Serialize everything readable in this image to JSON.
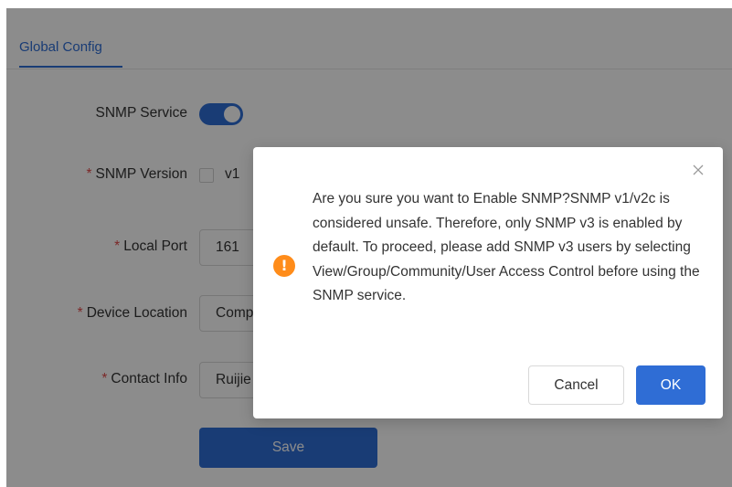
{
  "tabs": {
    "active_label": "Global Config"
  },
  "form": {
    "snmp_service_label": "SNMP Service",
    "snmp_service_on": true,
    "snmp_version_label": "SNMP Version",
    "snmp_version_option": "v1",
    "local_port_label": "Local Port",
    "local_port_value": "161",
    "device_location_label": "Device Location",
    "device_location_value": "Company Address",
    "contact_info_label": "Contact Info",
    "contact_info_value": "Ruijie Networks",
    "required_mark": "*",
    "save_label": "Save"
  },
  "dialog": {
    "message": "Are you sure you want to Enable SNMP?SNMP v1/v2c is considered unsafe. Therefore, only SNMP v3 is enabled by default. To proceed, please add SNMP v3 users by selecting View/Group/Community/User Access Control before using the SNMP service.",
    "cancel_label": "Cancel",
    "ok_label": "OK",
    "warning_glyph": "!",
    "icon": "warning-circle-icon"
  },
  "colors": {
    "primary": "#2f6dd5",
    "warning": "#ff8c1a",
    "required": "#e24a4a"
  }
}
